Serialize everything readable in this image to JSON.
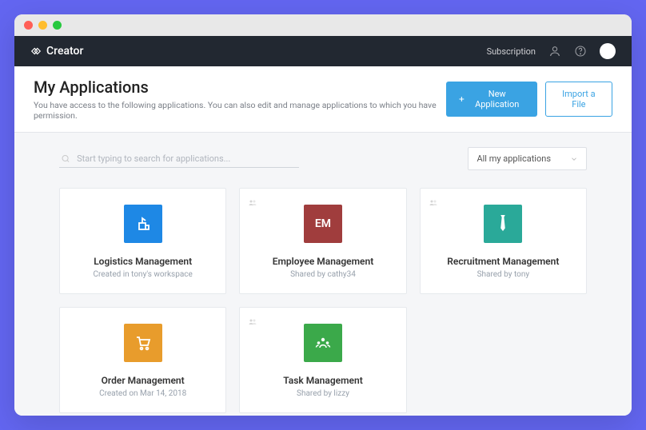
{
  "nav": {
    "brand": "Creator",
    "subscription": "Subscription"
  },
  "header": {
    "title": "My Applications",
    "subtitle": "You have access to the following applications. You can also edit and manage applications to which you have permission.",
    "new_app": "New Application",
    "import": "Import a File"
  },
  "toolbar": {
    "search_placeholder": "Start typing to search for applications...",
    "filter_selected": "All my applications"
  },
  "apps": [
    {
      "title": "Logistics Management",
      "sub": "Created in tony's workspace",
      "badge": "",
      "color": "c0",
      "icon": "logistics"
    },
    {
      "title": "Employee Management",
      "sub": "Shared by cathy34",
      "badge": "EM",
      "color": "c1",
      "icon": "text",
      "shared": true
    },
    {
      "title": "Recruitment Management",
      "sub": "Shared by tony",
      "badge": "",
      "color": "c2",
      "icon": "tie",
      "shared": true
    },
    {
      "title": "Order Management",
      "sub": "Created on Mar 14, 2018",
      "badge": "",
      "color": "c3",
      "icon": "cart"
    },
    {
      "title": "Task Management",
      "sub": "Shared by lizzy",
      "badge": "",
      "color": "c4",
      "icon": "team",
      "shared": true
    }
  ]
}
